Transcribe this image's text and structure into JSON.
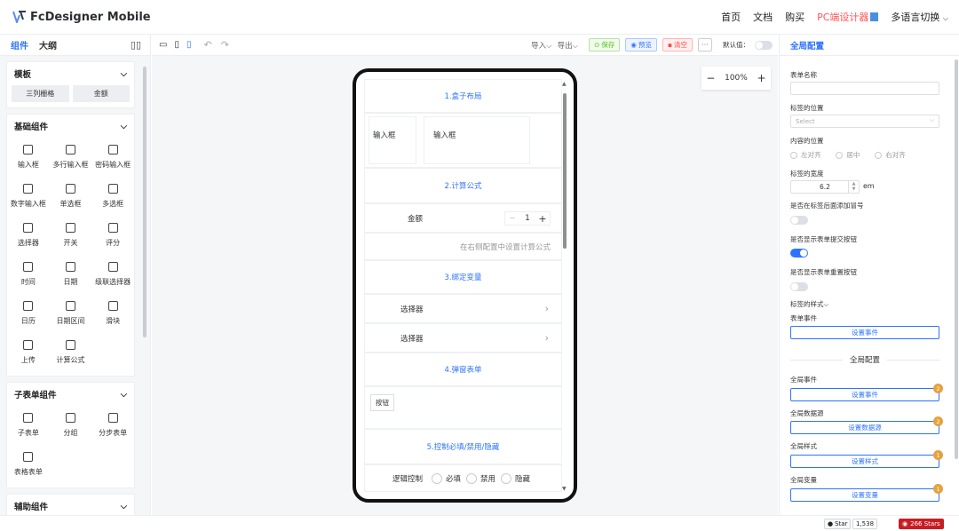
{
  "app": {
    "title": "FcDesigner Mobile"
  },
  "nav": {
    "home": "首页",
    "docs": "文档",
    "buy": "购买",
    "pc": "PC端设计器",
    "lang": "多语言切换"
  },
  "left": {
    "tab_components": "组件",
    "tab_outline": "大纲"
  },
  "groups": {
    "template": {
      "title": "模板",
      "items": [
        "三列栅格",
        "金额"
      ]
    },
    "basic": {
      "title": "基础组件",
      "items": [
        "输入框",
        "多行输入框",
        "密码输入框",
        "数字输入框",
        "单选框",
        "多选框",
        "选择器",
        "开关",
        "评分",
        "时间",
        "日期",
        "级联选择器",
        "日历",
        "日期区间",
        "滑块",
        "上传",
        "计算公式"
      ]
    },
    "sub": {
      "title": "子表单组件",
      "items": [
        "子表单",
        "分组",
        "分步表单",
        "表格表单"
      ]
    },
    "aux": {
      "title": "辅助组件"
    }
  },
  "toolbar": {
    "import": "导入",
    "export": "导出",
    "save": "保存",
    "preview": "预览",
    "clear": "清空",
    "more": "···",
    "default_label": "默认值："
  },
  "zoom": {
    "minus": "−",
    "value": "100%",
    "plus": "+"
  },
  "phone": {
    "sec1": "1.盒子布局",
    "input1": "输入框",
    "input2": "输入框",
    "sec2": "2.计算公式",
    "amount_label": "金额",
    "amount_value": "1",
    "formula_hint": "在右侧配置中设置计算公式",
    "sec3": "3.绑定变量",
    "select1": "选择器",
    "select2": "选择器",
    "sec4": "4.弹窗表单",
    "button": "按钮",
    "sec5": "5.控制必填/禁用/隐藏",
    "logic_label": "逻辑控制",
    "opt_required": "必填",
    "opt_disabled": "禁用",
    "opt_hidden": "隐藏"
  },
  "right": {
    "title": "全局配置",
    "form_name": "表单名称",
    "label_pos": "标签的位置",
    "select_ph": "Select",
    "content_pos": "内容的位置",
    "align_left": "左对齐",
    "align_center": "居中",
    "align_right": "右对齐",
    "label_width": "标签的宽度",
    "width_value": "6.2",
    "width_unit": "em",
    "colon": "是否在标签后面添加冒号",
    "show_submit": "是否显示表单提交按钮",
    "show_reset": "是否显示表单重置按钮",
    "label_style": "标签的样式",
    "form_event": "表单事件",
    "set_event": "设置事件",
    "global_config": "全局配置",
    "global_event": "全局事件",
    "global_event_btn": "设置事件",
    "global_event_count": "2",
    "global_source": "全局数据源",
    "global_source_btn": "设置数据源",
    "global_source_count": "2",
    "global_style": "全局样式",
    "global_style_btn": "设置样式",
    "global_style_count": "1",
    "global_var": "全局变量",
    "global_var_btn": "设置变量",
    "global_var_count": "1"
  },
  "footer": {
    "star": "Star",
    "star_count": "1,538",
    "stars2": "266 Stars"
  }
}
